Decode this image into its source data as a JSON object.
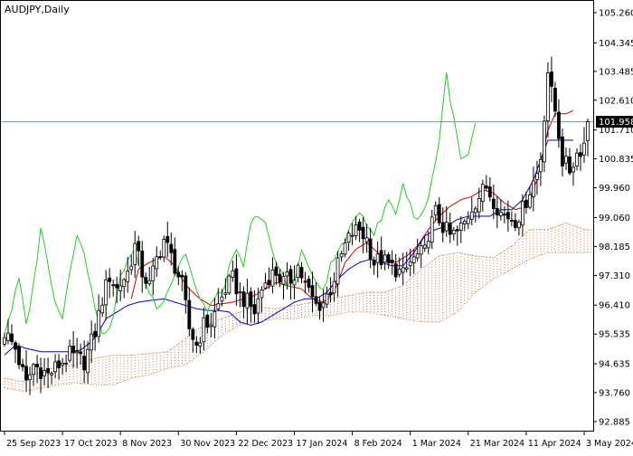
{
  "chart_data": {
    "type": "candlestick",
    "title": "AUDJPY,Daily",
    "current_price": {
      "value": 101.958,
      "label": "101.958"
    },
    "y_axis": {
      "range": [
        92.885,
        105.26
      ],
      "ticks": [
        {
          "value": 105.26,
          "label": "105.260"
        },
        {
          "value": 104.345,
          "label": "104.345"
        },
        {
          "value": 103.485,
          "label": "103.485"
        },
        {
          "value": 102.61,
          "label": "102.610"
        },
        {
          "value": 101.71,
          "label": "101.710"
        },
        {
          "value": 100.835,
          "label": "100.835"
        },
        {
          "value": 99.96,
          "label": "99.960"
        },
        {
          "value": 99.06,
          "label": "99.060"
        },
        {
          "value": 98.185,
          "label": "98.185"
        },
        {
          "value": 97.31,
          "label": "97.310"
        },
        {
          "value": 96.41,
          "label": "96.410"
        },
        {
          "value": 95.535,
          "label": "95.535"
        },
        {
          "value": 94.635,
          "label": "94.635"
        },
        {
          "value": 93.76,
          "label": "93.760"
        },
        {
          "value": 92.885,
          "label": "92.885"
        }
      ]
    },
    "x_axis": {
      "bar_count": 162,
      "ticks": [
        {
          "index": 0,
          "label": "25 Sep 2023"
        },
        {
          "index": 16,
          "label": "17 Oct 2023"
        },
        {
          "index": 32,
          "label": "8 Nov 2023"
        },
        {
          "index": 48,
          "label": "30 Nov 2023"
        },
        {
          "index": 64,
          "label": "22 Dec 2023"
        },
        {
          "index": 80,
          "label": "17 Jan 2024"
        },
        {
          "index": 96,
          "label": "8 Feb 2024"
        },
        {
          "index": 112,
          "label": "1 Mar 2024"
        },
        {
          "index": 128,
          "label": "21 Mar 2024"
        },
        {
          "index": 144,
          "label": "11 Apr 2024"
        },
        {
          "index": 160,
          "label": "3 May 2024"
        }
      ]
    },
    "close_keypoints": [
      [
        0,
        95.6
      ],
      [
        3,
        95.1
      ],
      [
        6,
        94.0
      ],
      [
        8,
        94.6
      ],
      [
        12,
        94.3
      ],
      [
        14,
        94.5
      ],
      [
        18,
        94.9
      ],
      [
        22,
        94.7
      ],
      [
        25,
        95.6
      ],
      [
        27,
        96.6
      ],
      [
        29,
        97.3
      ],
      [
        31,
        96.9
      ],
      [
        34,
        97.4
      ],
      [
        36,
        98.2
      ],
      [
        38,
        97.4
      ],
      [
        40,
        97.0
      ],
      [
        42,
        97.8
      ],
      [
        44,
        98.4
      ],
      [
        47,
        97.6
      ],
      [
        49,
        97.0
      ],
      [
        51,
        95.7
      ],
      [
        53,
        95.2
      ],
      [
        55,
        95.8
      ],
      [
        57,
        95.9
      ],
      [
        59,
        96.4
      ],
      [
        61,
        96.9
      ],
      [
        63,
        97.2
      ],
      [
        65,
        96.7
      ],
      [
        67,
        96.5
      ],
      [
        69,
        96.2
      ],
      [
        71,
        96.9
      ],
      [
        73,
        97.3
      ],
      [
        75,
        97.4
      ],
      [
        77,
        97.1
      ],
      [
        79,
        97.2
      ],
      [
        81,
        97.6
      ],
      [
        83,
        97.0
      ],
      [
        86,
        96.4
      ],
      [
        88,
        96.5
      ],
      [
        90,
        96.9
      ],
      [
        92,
        97.6
      ],
      [
        94,
        98.2
      ],
      [
        96,
        98.6
      ],
      [
        98,
        98.7
      ],
      [
        100,
        98.4
      ],
      [
        102,
        97.7
      ],
      [
        104,
        97.8
      ],
      [
        106,
        97.6
      ],
      [
        108,
        97.5
      ],
      [
        110,
        97.3
      ],
      [
        112,
        97.7
      ],
      [
        114,
        97.9
      ],
      [
        116,
        98.0
      ],
      [
        117,
        98.6
      ],
      [
        119,
        99.2
      ],
      [
        121,
        98.8
      ],
      [
        123,
        98.5
      ],
      [
        125,
        98.6
      ],
      [
        127,
        98.9
      ],
      [
        129,
        99.4
      ],
      [
        131,
        99.7
      ],
      [
        133,
        100.0
      ],
      [
        135,
        99.6
      ],
      [
        137,
        99.2
      ],
      [
        139,
        99.1
      ],
      [
        141,
        99.0
      ],
      [
        143,
        99.3
      ],
      [
        145,
        99.9
      ],
      [
        147,
        100.4
      ],
      [
        148,
        100.9
      ],
      [
        150,
        103.5
      ],
      [
        151,
        102.8
      ],
      [
        152,
        102.3
      ],
      [
        153,
        101.6
      ],
      [
        154,
        100.8
      ],
      [
        156,
        100.5
      ],
      [
        158,
        101.0
      ],
      [
        160,
        101.3
      ],
      [
        161,
        101.958
      ]
    ],
    "series": [
      {
        "kind": "tenkan",
        "color": "#cc0000",
        "x_offset": 0,
        "x_start": 35,
        "keypoints": [
          [
            35,
            96.6
          ],
          [
            37,
            97.5
          ],
          [
            40,
            97.7
          ],
          [
            44,
            97.9
          ],
          [
            47,
            97.6
          ],
          [
            49,
            97.2
          ],
          [
            51,
            96.9
          ],
          [
            54,
            96.6
          ],
          [
            57,
            96.4
          ],
          [
            60,
            96.45
          ],
          [
            63,
            96.5
          ],
          [
            66,
            96.6
          ],
          [
            69,
            96.7
          ],
          [
            72,
            96.9
          ],
          [
            75,
            97.1
          ],
          [
            78,
            97.0
          ],
          [
            82,
            96.9
          ],
          [
            85,
            96.6
          ],
          [
            88,
            96.5
          ],
          [
            91,
            96.8
          ],
          [
            94,
            97.7
          ],
          [
            97,
            98.1
          ],
          [
            100,
            98.3
          ],
          [
            102,
            98.1
          ],
          [
            105,
            97.8
          ],
          [
            108,
            97.7
          ],
          [
            111,
            97.9
          ],
          [
            114,
            98.2
          ],
          [
            117,
            98.7
          ],
          [
            120,
            99.1
          ],
          [
            123,
            99.4
          ],
          [
            126,
            99.6
          ],
          [
            129,
            99.7
          ],
          [
            132,
            99.9
          ],
          [
            135,
            99.8
          ],
          [
            138,
            99.5
          ],
          [
            141,
            99.3
          ],
          [
            144,
            99.4
          ],
          [
            147,
            100.2
          ],
          [
            150,
            101.7
          ],
          [
            152,
            102.2
          ],
          [
            155,
            102.2
          ],
          [
            157,
            102.3
          ]
        ]
      },
      {
        "kind": "kijun",
        "color": "#0000cc",
        "x_offset": 0,
        "x_start": 0,
        "keypoints": [
          [
            0,
            94.9
          ],
          [
            3,
            95.2
          ],
          [
            6,
            95.1
          ],
          [
            10,
            95.0
          ],
          [
            14,
            95.0
          ],
          [
            18,
            95.0
          ],
          [
            21,
            95.05
          ],
          [
            24,
            95.3
          ],
          [
            26,
            95.6
          ],
          [
            28,
            96.0
          ],
          [
            31,
            96.2
          ],
          [
            34,
            96.4
          ],
          [
            37,
            96.5
          ],
          [
            40,
            96.55
          ],
          [
            44,
            96.6
          ],
          [
            47,
            96.5
          ],
          [
            50,
            96.4
          ],
          [
            53,
            96.3
          ],
          [
            56,
            96.25
          ],
          [
            59,
            96.25
          ],
          [
            62,
            96.2
          ],
          [
            65,
            95.9
          ],
          [
            68,
            95.8
          ],
          [
            71,
            95.9
          ],
          [
            74,
            96.1
          ],
          [
            77,
            96.3
          ],
          [
            80,
            96.5
          ],
          [
            83,
            96.6
          ],
          [
            86,
            96.6
          ],
          [
            89,
            96.8
          ],
          [
            92,
            97.2
          ],
          [
            95,
            97.5
          ],
          [
            98,
            97.7
          ],
          [
            101,
            97.8
          ],
          [
            104,
            97.7
          ],
          [
            107,
            97.6
          ],
          [
            110,
            97.6
          ],
          [
            113,
            98.0
          ],
          [
            116,
            98.5
          ],
          [
            119,
            98.7
          ],
          [
            122,
            98.8
          ],
          [
            125,
            99.0
          ],
          [
            128,
            99.1
          ],
          [
            131,
            99.1
          ],
          [
            134,
            99.1
          ],
          [
            137,
            99.3
          ],
          [
            140,
            99.3
          ],
          [
            143,
            99.6
          ],
          [
            146,
            100.2
          ],
          [
            148,
            100.8
          ],
          [
            150,
            101.4
          ],
          [
            153,
            101.4
          ],
          [
            157,
            101.4
          ]
        ]
      },
      {
        "kind": "chikou",
        "color": "#22cc22",
        "x_offset": 0,
        "x_start": 0,
        "keypoints": [
          [
            0,
            95.6
          ],
          [
            2,
            96.3
          ],
          [
            4,
            97.2
          ],
          [
            6,
            95.8
          ],
          [
            8,
            97.0
          ],
          [
            10,
            98.8
          ],
          [
            12,
            97.6
          ],
          [
            14,
            96.6
          ],
          [
            16,
            96.0
          ],
          [
            18,
            97.5
          ],
          [
            20,
            98.6
          ],
          [
            22,
            97.9
          ],
          [
            24,
            97.0
          ],
          [
            26,
            95.8
          ],
          [
            28,
            95.5
          ],
          [
            30,
            96.0
          ],
          [
            32,
            97.3
          ],
          [
            34,
            97.8
          ],
          [
            36,
            98.0
          ],
          [
            38,
            97.4
          ],
          [
            40,
            96.8
          ],
          [
            42,
            96.4
          ],
          [
            44,
            96.6
          ],
          [
            46,
            97.1
          ],
          [
            48,
            97.6
          ],
          [
            50,
            98.0
          ],
          [
            52,
            97.2
          ],
          [
            54,
            96.5
          ],
          [
            56,
            96.3
          ],
          [
            58,
            96.6
          ],
          [
            60,
            96.8
          ],
          [
            62,
            97.5
          ],
          [
            64,
            98.0
          ],
          [
            66,
            97.6
          ],
          [
            68,
            98.8
          ],
          [
            70,
            99.2
          ],
          [
            72,
            98.9
          ],
          [
            74,
            97.9
          ],
          [
            76,
            97.5
          ],
          [
            78,
            97.0
          ],
          [
            80,
            97.2
          ],
          [
            82,
            98.0
          ],
          [
            84,
            97.6
          ],
          [
            86,
            97.0
          ],
          [
            88,
            96.9
          ],
          [
            90,
            97.6
          ],
          [
            92,
            98.0
          ],
          [
            94,
            98.4
          ],
          [
            96,
            98.8
          ],
          [
            98,
            99.3
          ],
          [
            100,
            98.9
          ],
          [
            102,
            98.6
          ],
          [
            104,
            99.0
          ],
          [
            106,
            99.6
          ],
          [
            108,
            99.2
          ],
          [
            110,
            100.1
          ],
          [
            112,
            99.4
          ],
          [
            114,
            99.0
          ],
          [
            116,
            99.3
          ],
          [
            118,
            100.2
          ],
          [
            120,
            101.4
          ],
          [
            122,
            103.4
          ],
          [
            124,
            102.0
          ],
          [
            126,
            100.8
          ],
          [
            128,
            100.9
          ],
          [
            130,
            101.9
          ]
        ]
      },
      {
        "kind": "span_a",
        "color": "#d2691e",
        "x_offset": 0,
        "x_start": 0,
        "keypoints": [
          [
            0,
            94.2
          ],
          [
            5,
            94.1
          ],
          [
            10,
            94.4
          ],
          [
            15,
            94.55
          ],
          [
            20,
            94.6
          ],
          [
            25,
            94.8
          ],
          [
            30,
            94.9
          ],
          [
            35,
            94.9
          ],
          [
            40,
            94.95
          ],
          [
            45,
            95.0
          ],
          [
            50,
            95.4
          ],
          [
            55,
            95.8
          ],
          [
            60,
            96.0
          ],
          [
            65,
            96.2
          ],
          [
            70,
            96.35
          ],
          [
            75,
            96.3
          ],
          [
            80,
            96.4
          ],
          [
            85,
            96.5
          ],
          [
            90,
            96.6
          ],
          [
            95,
            96.7
          ],
          [
            100,
            96.8
          ],
          [
            105,
            96.8
          ],
          [
            110,
            97.0
          ],
          [
            115,
            97.5
          ],
          [
            120,
            97.9
          ],
          [
            125,
            98.0
          ],
          [
            130,
            97.9
          ],
          [
            135,
            97.85
          ],
          [
            140,
            98.2
          ],
          [
            145,
            98.7
          ],
          [
            150,
            98.7
          ],
          [
            155,
            98.9
          ],
          [
            160,
            98.7
          ],
          [
            162,
            98.7
          ]
        ]
      },
      {
        "kind": "span_b",
        "color": "#d2691e",
        "x_offset": 0,
        "x_start": 0,
        "keypoints": [
          [
            0,
            93.9
          ],
          [
            5,
            93.8
          ],
          [
            10,
            93.9
          ],
          [
            15,
            94.0
          ],
          [
            20,
            94.05
          ],
          [
            25,
            94.0
          ],
          [
            30,
            94.0
          ],
          [
            35,
            94.2
          ],
          [
            40,
            94.3
          ],
          [
            45,
            94.5
          ],
          [
            50,
            94.6
          ],
          [
            55,
            95.0
          ],
          [
            60,
            95.5
          ],
          [
            65,
            95.8
          ],
          [
            70,
            95.9
          ],
          [
            75,
            96.0
          ],
          [
            80,
            96.0
          ],
          [
            85,
            96.1
          ],
          [
            90,
            96.1
          ],
          [
            95,
            96.2
          ],
          [
            100,
            96.2
          ],
          [
            105,
            96.1
          ],
          [
            110,
            96.0
          ],
          [
            115,
            95.9
          ],
          [
            120,
            95.9
          ],
          [
            125,
            96.2
          ],
          [
            130,
            96.8
          ],
          [
            135,
            97.2
          ],
          [
            140,
            97.5
          ],
          [
            145,
            97.8
          ],
          [
            150,
            98.0
          ],
          [
            155,
            98.0
          ],
          [
            160,
            98.0
          ],
          [
            162,
            98.0
          ]
        ]
      }
    ],
    "grid": false
  }
}
